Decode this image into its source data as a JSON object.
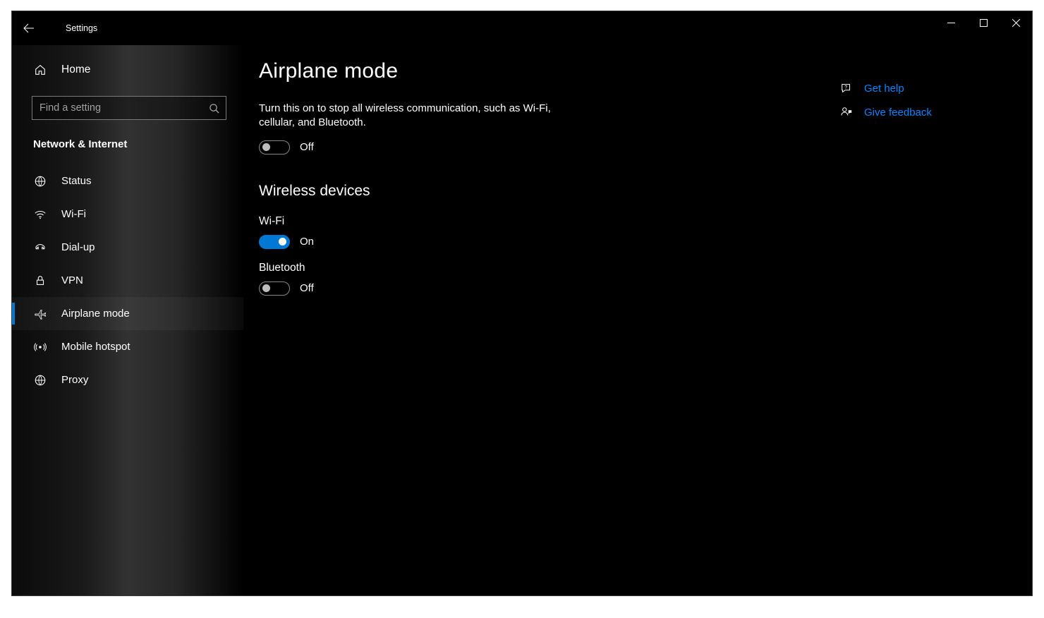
{
  "app": {
    "title": "Settings"
  },
  "home": {
    "label": "Home"
  },
  "search": {
    "placeholder": "Find a setting"
  },
  "section": {
    "label": "Network & Internet"
  },
  "nav": {
    "status": {
      "label": "Status"
    },
    "wifi": {
      "label": "Wi-Fi"
    },
    "dialup": {
      "label": "Dial-up"
    },
    "vpn": {
      "label": "VPN"
    },
    "airplane": {
      "label": "Airplane mode"
    },
    "hotspot": {
      "label": "Mobile hotspot"
    },
    "proxy": {
      "label": "Proxy"
    }
  },
  "page": {
    "title": "Airplane mode",
    "desc": "Turn this on to stop all wireless communication, such as Wi-Fi, cellular, and Bluetooth.",
    "airplane_state": "Off",
    "wireless_heading": "Wireless devices",
    "wifi_label": "Wi-Fi",
    "wifi_state": "On",
    "bt_label": "Bluetooth",
    "bt_state": "Off"
  },
  "rail": {
    "help": "Get help",
    "feedback": "Give feedback"
  }
}
